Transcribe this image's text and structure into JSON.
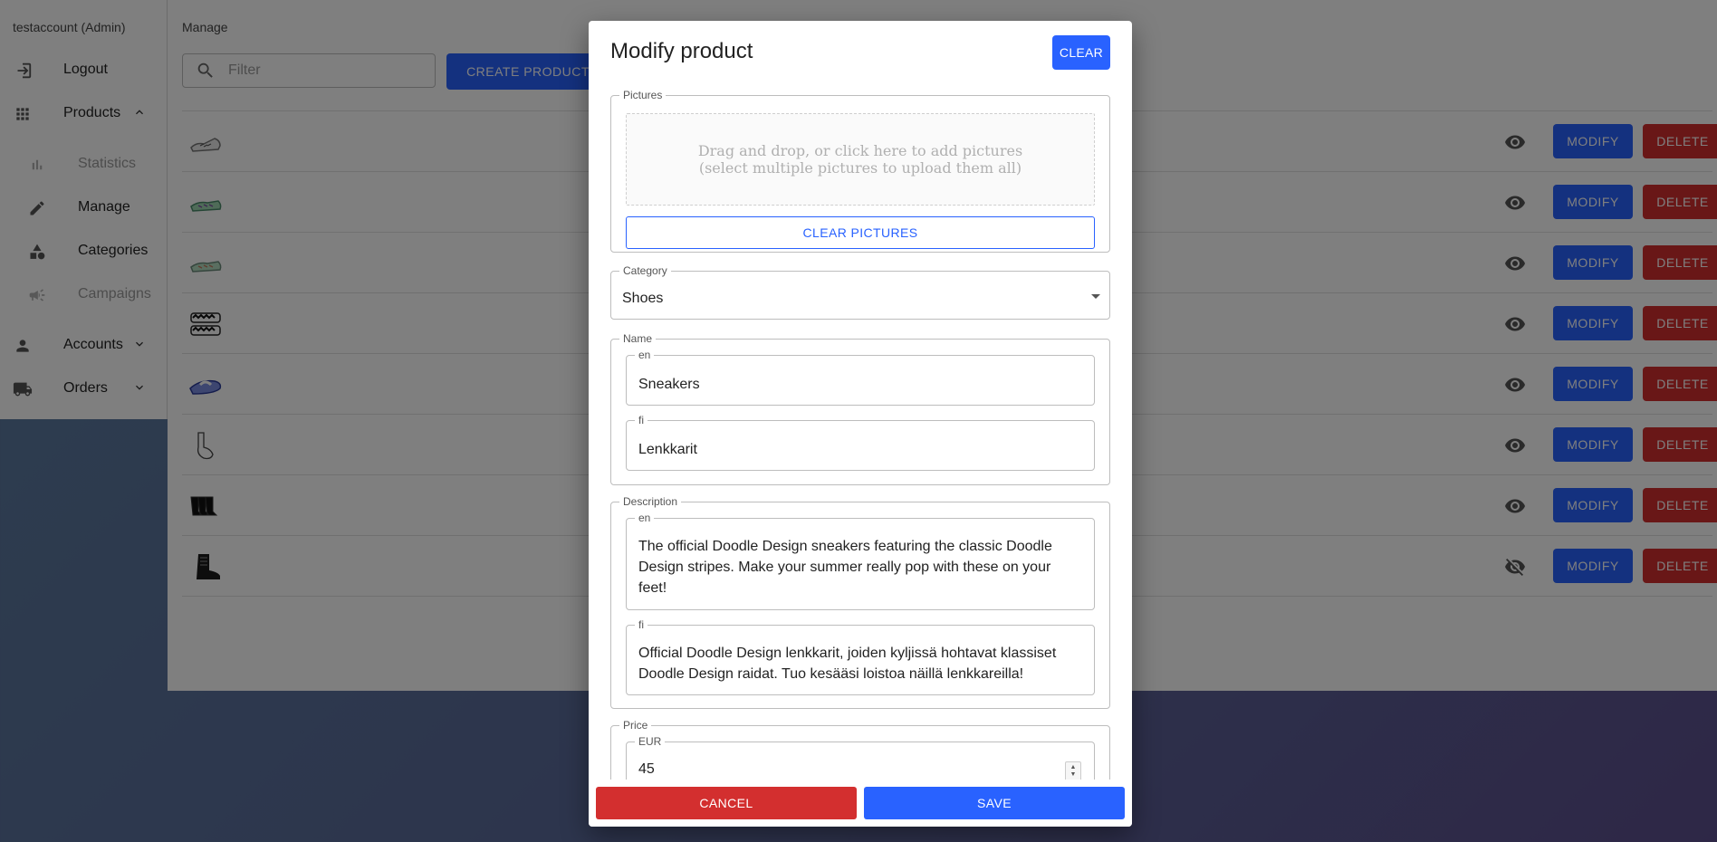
{
  "sidebar": {
    "user": "testaccount (Admin)",
    "logout": "Logout",
    "products": "Products",
    "statistics": "Statistics",
    "manage": "Manage",
    "categories": "Categories",
    "campaigns": "Campaigns",
    "accounts": "Accounts",
    "orders": "Orders"
  },
  "main": {
    "breadcrumb": "Manage",
    "filter_placeholder": "Filter",
    "create_button": "CREATE PRODUCT",
    "rows": [
      {
        "thumb": "sneaker-gray",
        "visible": true,
        "modify": "MODIFY",
        "delete": "DELETE"
      },
      {
        "thumb": "sneaker-green",
        "visible": true,
        "modify": "MODIFY",
        "delete": "DELETE"
      },
      {
        "thumb": "sneaker-striped",
        "visible": true,
        "modify": "MODIFY",
        "delete": "DELETE"
      },
      {
        "thumb": "socks-zigzag",
        "visible": true,
        "modify": "MODIFY",
        "delete": "DELETE"
      },
      {
        "thumb": "slipper-blue",
        "visible": true,
        "modify": "MODIFY",
        "delete": "DELETE"
      },
      {
        "thumb": "sock-outline",
        "visible": true,
        "modify": "MODIFY",
        "delete": "DELETE"
      },
      {
        "thumb": "socks-black",
        "visible": true,
        "modify": "MODIFY",
        "delete": "DELETE"
      },
      {
        "thumb": "boot-black",
        "visible": false,
        "modify": "MODIFY",
        "delete": "DELETE"
      }
    ]
  },
  "modal": {
    "title": "Modify product",
    "clear_button": "CLEAR",
    "pictures": {
      "legend": "Pictures",
      "dropzone_line1": "Drag and drop, or click here to add pictures",
      "dropzone_line2": "(select multiple pictures to upload them all)",
      "clear_button": "CLEAR PICTURES"
    },
    "category": {
      "legend": "Category",
      "value": "Shoes"
    },
    "name": {
      "legend": "Name",
      "en_label": "en",
      "en_value": "Sneakers",
      "fi_label": "fi",
      "fi_value": "Lenkkarit"
    },
    "description": {
      "legend": "Description",
      "en_label": "en",
      "en_value": "The official Doodle Design sneakers featuring the classic Doodle Design stripes. Make your summer really pop with these on your feet!",
      "fi_label": "fi",
      "fi_value": "Official Doodle Design lenkkarit, joiden kyljissä hohtavat klassiset Doodle Design raidat. Tuo kesääsi loistoa näillä lenkkareilla!"
    },
    "price": {
      "legend": "Price",
      "currency_label": "EUR",
      "value": "45"
    },
    "cancel_button": "CANCEL",
    "save_button": "SAVE"
  },
  "colors": {
    "primary": "#2962ff",
    "danger": "#d32f2f",
    "background_start": "#5a7fa0",
    "background_end": "#5c4f8e"
  }
}
